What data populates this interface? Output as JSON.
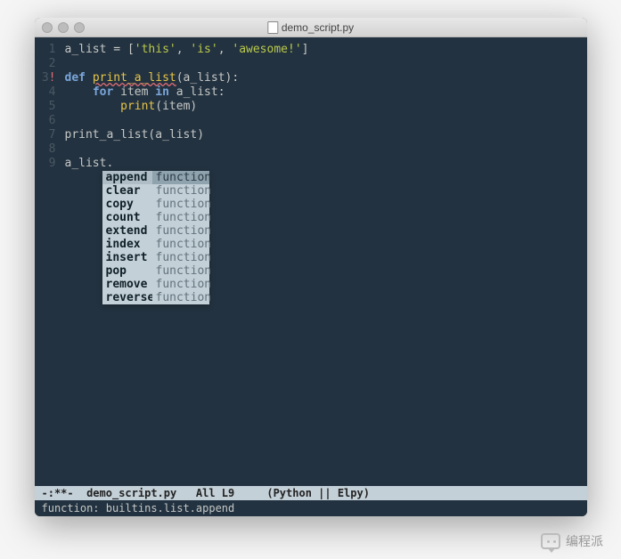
{
  "window": {
    "title": "demo_script.py"
  },
  "code": {
    "lines": [
      {
        "num": "1",
        "tokens": [
          {
            "t": "a_list = [",
            "c": "param"
          },
          {
            "t": "'this'",
            "c": "str"
          },
          {
            "t": ", ",
            "c": "param"
          },
          {
            "t": "'is'",
            "c": "str"
          },
          {
            "t": ", ",
            "c": "param"
          },
          {
            "t": "'awesome!'",
            "c": "str"
          },
          {
            "t": "]",
            "c": "param"
          }
        ]
      },
      {
        "num": "2",
        "tokens": []
      },
      {
        "num": "3",
        "flag": "!",
        "tokens": [
          {
            "t": "def ",
            "c": "kw"
          },
          {
            "t": "print_a_list",
            "c": "fn underline"
          },
          {
            "t": "(a_list):",
            "c": "param"
          }
        ]
      },
      {
        "num": "4",
        "tokens": [
          {
            "t": "    ",
            "c": "param"
          },
          {
            "t": "for ",
            "c": "kw"
          },
          {
            "t": "item ",
            "c": "param"
          },
          {
            "t": "in ",
            "c": "kw"
          },
          {
            "t": "a_list:",
            "c": "param"
          }
        ]
      },
      {
        "num": "5",
        "tokens": [
          {
            "t": "        ",
            "c": "param"
          },
          {
            "t": "print",
            "c": "fn"
          },
          {
            "t": "(item)",
            "c": "param"
          }
        ]
      },
      {
        "num": "6",
        "tokens": []
      },
      {
        "num": "7",
        "tokens": [
          {
            "t": "print_a_list(a_list)",
            "c": "param"
          }
        ]
      },
      {
        "num": "8",
        "tokens": []
      },
      {
        "num": "9",
        "tokens": [
          {
            "t": "a_list.",
            "c": "param"
          }
        ]
      }
    ]
  },
  "autocomplete": {
    "items": [
      {
        "name": "append",
        "type": "function",
        "selected": true
      },
      {
        "name": "clear",
        "type": "function"
      },
      {
        "name": "copy",
        "type": "function"
      },
      {
        "name": "count",
        "type": "function"
      },
      {
        "name": "extend",
        "type": "function"
      },
      {
        "name": "index",
        "type": "function"
      },
      {
        "name": "insert",
        "type": "function"
      },
      {
        "name": "pop",
        "type": "function"
      },
      {
        "name": "remove",
        "type": "function"
      },
      {
        "name": "reverse",
        "type": "function"
      }
    ]
  },
  "statusbar": "-:**-  demo_script.py   All L9     (Python || Elpy)",
  "minibuffer": "function: builtins.list.append",
  "watermark": "编程派"
}
